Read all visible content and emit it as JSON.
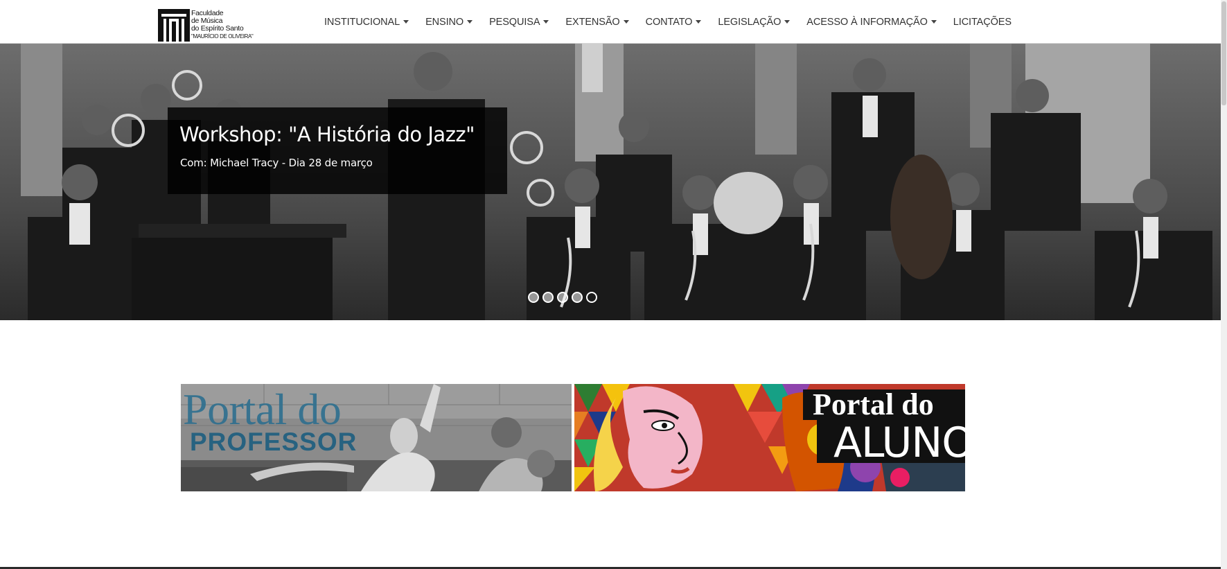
{
  "site": {
    "logo": {
      "icon": "faculty-logo-icon",
      "lines": [
        "Faculdade",
        "de Música",
        "do Espírito Santo",
        "\"MAURÍCIO DE OLIVEIRA\""
      ]
    }
  },
  "nav": {
    "items": [
      {
        "label": "INSTITUCIONAL",
        "has_dropdown": true
      },
      {
        "label": "ENSINO",
        "has_dropdown": true
      },
      {
        "label": "PESQUISA",
        "has_dropdown": true
      },
      {
        "label": "EXTENSÃO",
        "has_dropdown": true
      },
      {
        "label": "CONTATO",
        "has_dropdown": true
      },
      {
        "label": "LEGISLAÇÃO",
        "has_dropdown": true
      },
      {
        "label": "ACESSO À INFORMAÇÃO",
        "has_dropdown": true
      },
      {
        "label": "LICITAÇÕES",
        "has_dropdown": false
      }
    ]
  },
  "carousel": {
    "slide": {
      "title": "Workshop: \"A História do Jazz\"",
      "subtitle": "Com: Michael Tracy - Dia 28 de março",
      "image": "jazz-band-photo"
    },
    "indicator_count": 5,
    "active_index": 4
  },
  "portals": {
    "professor": {
      "line1": "Portal do",
      "line2": "PROFESSOR",
      "image": "socrates-painting"
    },
    "aluno": {
      "line1": "Portal do",
      "line2": "ALUNO",
      "image": "cubist-portrait-painting"
    }
  },
  "colors": {
    "nav_text": "#333333",
    "caption_bg": "#000000",
    "professor_text": "#2e6f8f",
    "aluno_text": "#ffffff"
  }
}
